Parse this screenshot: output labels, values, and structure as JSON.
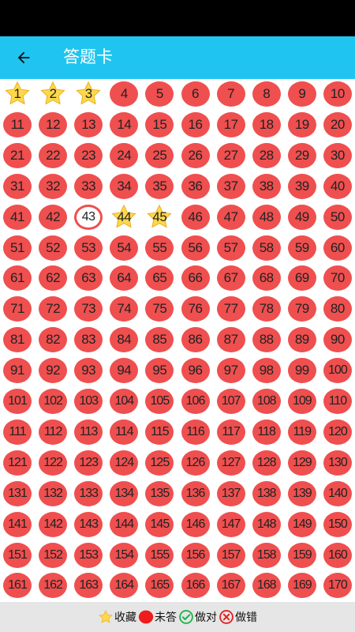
{
  "app_bar": {
    "back_icon": "arrow-left-icon",
    "title": "答题卡",
    "background": "#1fc5f0"
  },
  "grid": {
    "total": 170,
    "columns": 10,
    "starred": [
      1,
      2,
      3,
      44,
      45
    ],
    "current": [
      43
    ],
    "unanswered_color": "#ef4f4f",
    "star_color": "#ffd84a"
  },
  "legend": {
    "starred_label": "收藏",
    "unanswered_label": "未答",
    "correct_label": "做对",
    "wrong_label": "做错"
  }
}
